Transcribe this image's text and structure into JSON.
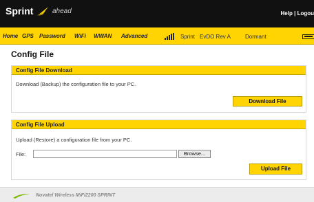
{
  "header": {
    "brand": "Sprint",
    "tagline": "ahead",
    "help_link": "Help",
    "separator": "|",
    "logout_link": "Logou",
    "brand_color": "#ffd400"
  },
  "nav": {
    "items": [
      "Home",
      "GPS",
      "Password",
      "WiFi",
      "WWAN",
      "Advanced"
    ],
    "carrier": "Sprint",
    "network": "EvDO Rev A",
    "connection_status": "Dormant",
    "signal_icon": "signal-bars-icon",
    "battery_icon": "battery-icon"
  },
  "page": {
    "title": "Config File"
  },
  "download": {
    "heading": "Config File Download",
    "description": "Download (Backup) the configuration file to your PC.",
    "button": "Download File"
  },
  "upload": {
    "heading": "Config File Upload",
    "description": "Upload (Restore) a configuration file from your PC.",
    "file_label": "File:",
    "file_value": "",
    "browse_button": "Browse...",
    "button": "Upload File"
  },
  "footer": {
    "text": "Novatel Wireless MiFi2200 SPRINT",
    "logo_icon": "novatel-swoosh-icon"
  }
}
